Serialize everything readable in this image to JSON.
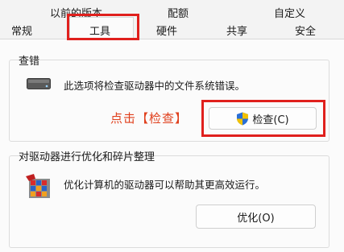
{
  "tabs_row1": [
    "以前的版本",
    "配额",
    "自定义"
  ],
  "tabs_row2": [
    "常规",
    "工具",
    "硬件",
    "共享",
    "安全"
  ],
  "check_group": {
    "title": "查错",
    "description": "此选项将检查驱动器中的文件系统错误。",
    "button_label": "检查(C)"
  },
  "annotation": "点击【检查】",
  "optimize_group": {
    "title": "对驱动器进行优化和碎片整理",
    "description": "优化计算机的驱动器可以帮助其更高效运行。",
    "button_label": "优化(O)"
  },
  "colors": {
    "highlight": "#e0201d",
    "annotation": "#e0401d"
  },
  "icons": [
    "drive-icon",
    "shield-icon",
    "defrag-icon"
  ]
}
